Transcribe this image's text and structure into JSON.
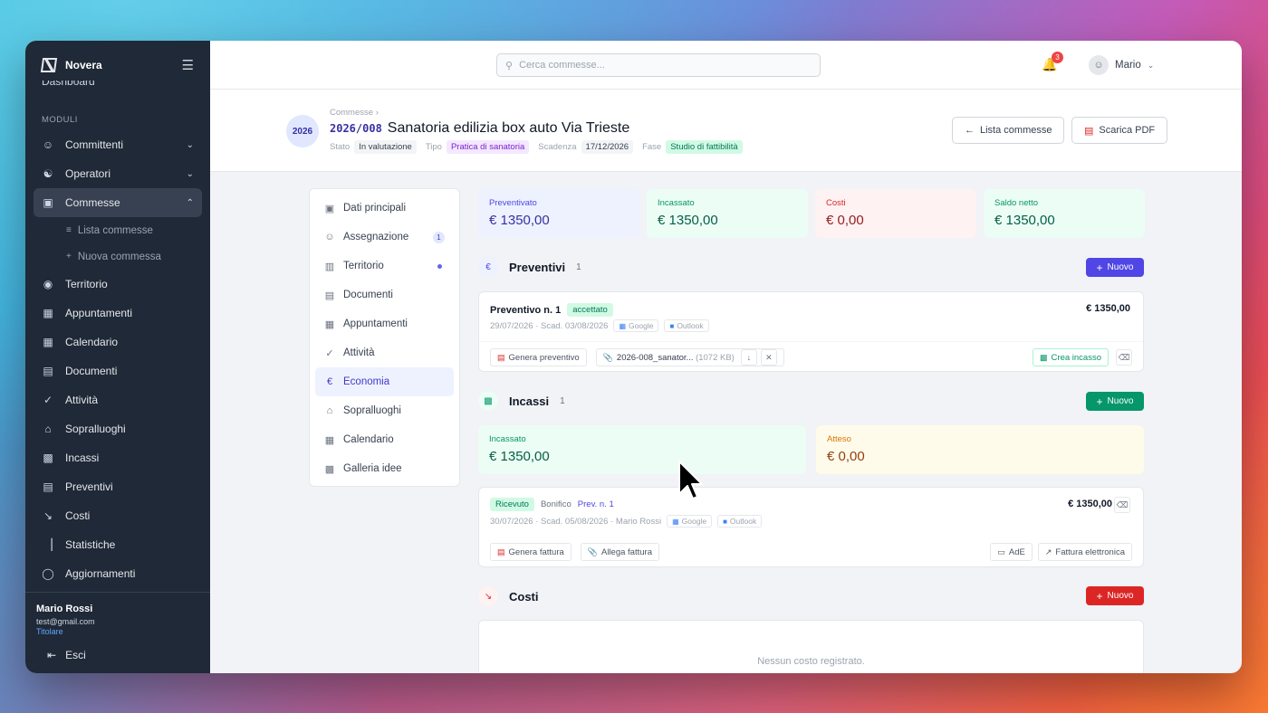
{
  "app": {
    "name": "Novera",
    "dashboard_cut": "Dashboard"
  },
  "sidebar": {
    "section": "MODULI",
    "items": [
      {
        "label": "Committenti",
        "icon": "users-icon"
      },
      {
        "label": "Operatori",
        "icon": "operator-icon"
      },
      {
        "label": "Commesse",
        "icon": "folder-icon"
      },
      {
        "label": "Territorio",
        "icon": "map-pin-icon"
      },
      {
        "label": "Appuntamenti",
        "icon": "calendar-icon"
      },
      {
        "label": "Calendario",
        "icon": "calendar-icon"
      },
      {
        "label": "Documenti",
        "icon": "document-icon"
      },
      {
        "label": "Attività",
        "icon": "check-circle-icon"
      },
      {
        "label": "Sopralluoghi",
        "icon": "home-icon"
      },
      {
        "label": "Incassi",
        "icon": "cash-icon"
      },
      {
        "label": "Preventivi",
        "icon": "file-icon"
      },
      {
        "label": "Costi",
        "icon": "trend-down-icon"
      },
      {
        "label": "Statistiche",
        "icon": "bar-chart-icon"
      },
      {
        "label": "Aggiornamenti",
        "icon": "chat-icon"
      }
    ],
    "sub_items": [
      "Lista commesse",
      "Nuova commessa"
    ],
    "user": {
      "name": "Mario Rossi",
      "email": "test@gmail.com",
      "role": "Titolare"
    },
    "logout": "Esci"
  },
  "topbar": {
    "search_placeholder": "Cerca commesse...",
    "notifications": "3",
    "user": "Mario"
  },
  "header": {
    "year": "2026",
    "breadcrumb": "Commesse",
    "code": "2026/008",
    "title": "Sanatoria edilizia box auto Via Trieste",
    "meta": {
      "stato_label": "Stato",
      "stato": "In valutazione",
      "tipo_label": "Tipo",
      "tipo": "Pratica di sanatoria",
      "scadenza_label": "Scadenza",
      "scadenza": "17/12/2026",
      "fase_label": "Fase",
      "fase": "Studio di fattibilità"
    },
    "btn_list": "Lista commesse",
    "btn_pdf": "Scarica PDF"
  },
  "subnav": {
    "items": [
      {
        "label": "Dati principali"
      },
      {
        "label": "Assegnazione",
        "badge": "1"
      },
      {
        "label": "Territorio"
      },
      {
        "label": "Documenti"
      },
      {
        "label": "Appuntamenti"
      },
      {
        "label": "Attività"
      },
      {
        "label": "Economia"
      },
      {
        "label": "Sopralluoghi"
      },
      {
        "label": "Calendario"
      },
      {
        "label": "Galleria idee"
      }
    ]
  },
  "stats": [
    {
      "label": "Preventivato",
      "value": "€ 1350,00"
    },
    {
      "label": "Incassato",
      "value": "€ 1350,00"
    },
    {
      "label": "Costi",
      "value": "€ 0,00"
    },
    {
      "label": "Saldo netto",
      "value": "€ 1350,00"
    }
  ],
  "preventivi": {
    "title": "Preventivi",
    "count": "1",
    "new_btn": "Nuovo",
    "card": {
      "title": "Preventivo n. 1",
      "status": "accettato",
      "amount": "€ 1350,00",
      "date": "29/07/2026",
      "due": "· Scad. 03/08/2026",
      "google": "Google",
      "outlook": "Outlook",
      "btn_generate": "Genera preventivo",
      "file": "2026-008_sanator...",
      "file_size": "(1072 KB)",
      "btn_incasso": "Crea incasso"
    }
  },
  "incassi": {
    "title": "Incassi",
    "count": "1",
    "new_btn": "Nuovo",
    "incassato_label": "Incassato",
    "incassato": "€ 1350,00",
    "atteso_label": "Atteso",
    "atteso": "€ 0,00",
    "card": {
      "status": "Ricevuto",
      "method": "Bonifico",
      "ref": "Prev. n. 1",
      "amount": "€ 1350,00",
      "date": "30/07/2026",
      "due": "· Scad. 05/08/2026",
      "person": "· Mario Rossi",
      "google": "Google",
      "outlook": "Outlook",
      "btn_invoice": "Genera fattura",
      "btn_attach": "Allega fattura",
      "btn_ade": "AdE",
      "btn_einvoice": "Fattura elettronica"
    }
  },
  "costi": {
    "title": "Costi",
    "new_btn": "Nuovo",
    "empty": "Nessun costo registrato."
  }
}
